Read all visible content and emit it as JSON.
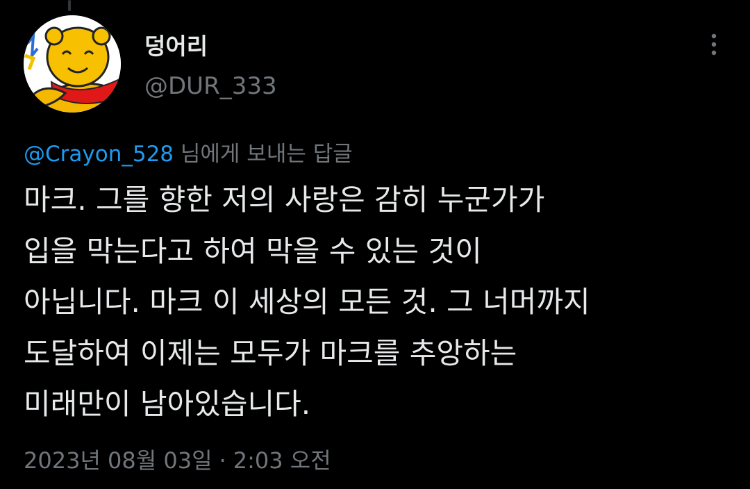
{
  "author": {
    "display_name": "덩어리",
    "handle": "@DUR_333",
    "avatar_icon": "cartoon-avatar"
  },
  "menu": {
    "icon": "more-vertical-icon"
  },
  "reply": {
    "mention": "@Crayon_528",
    "suffix": " 님에게 보내는 답글"
  },
  "tweet": {
    "lines": [
      "마크. 그를 향한 저의 사랑은 감히 누군가가",
      "입을 막는다고 하여 막을 수 있는 것이",
      "아닙니다. 마크 이 세상의 모든 것. 그 너머까지",
      "도달하여 이제는 모두가 마크를 추앙하는",
      "미래만이 남아있습니다."
    ]
  },
  "meta": {
    "date": "2023년 08월 03일",
    "separator": "·",
    "time": "2:03 오전"
  },
  "colors": {
    "background": "#000000",
    "text_primary": "#e7e9ea",
    "text_secondary": "#71767b",
    "link": "#1d9bf0"
  }
}
